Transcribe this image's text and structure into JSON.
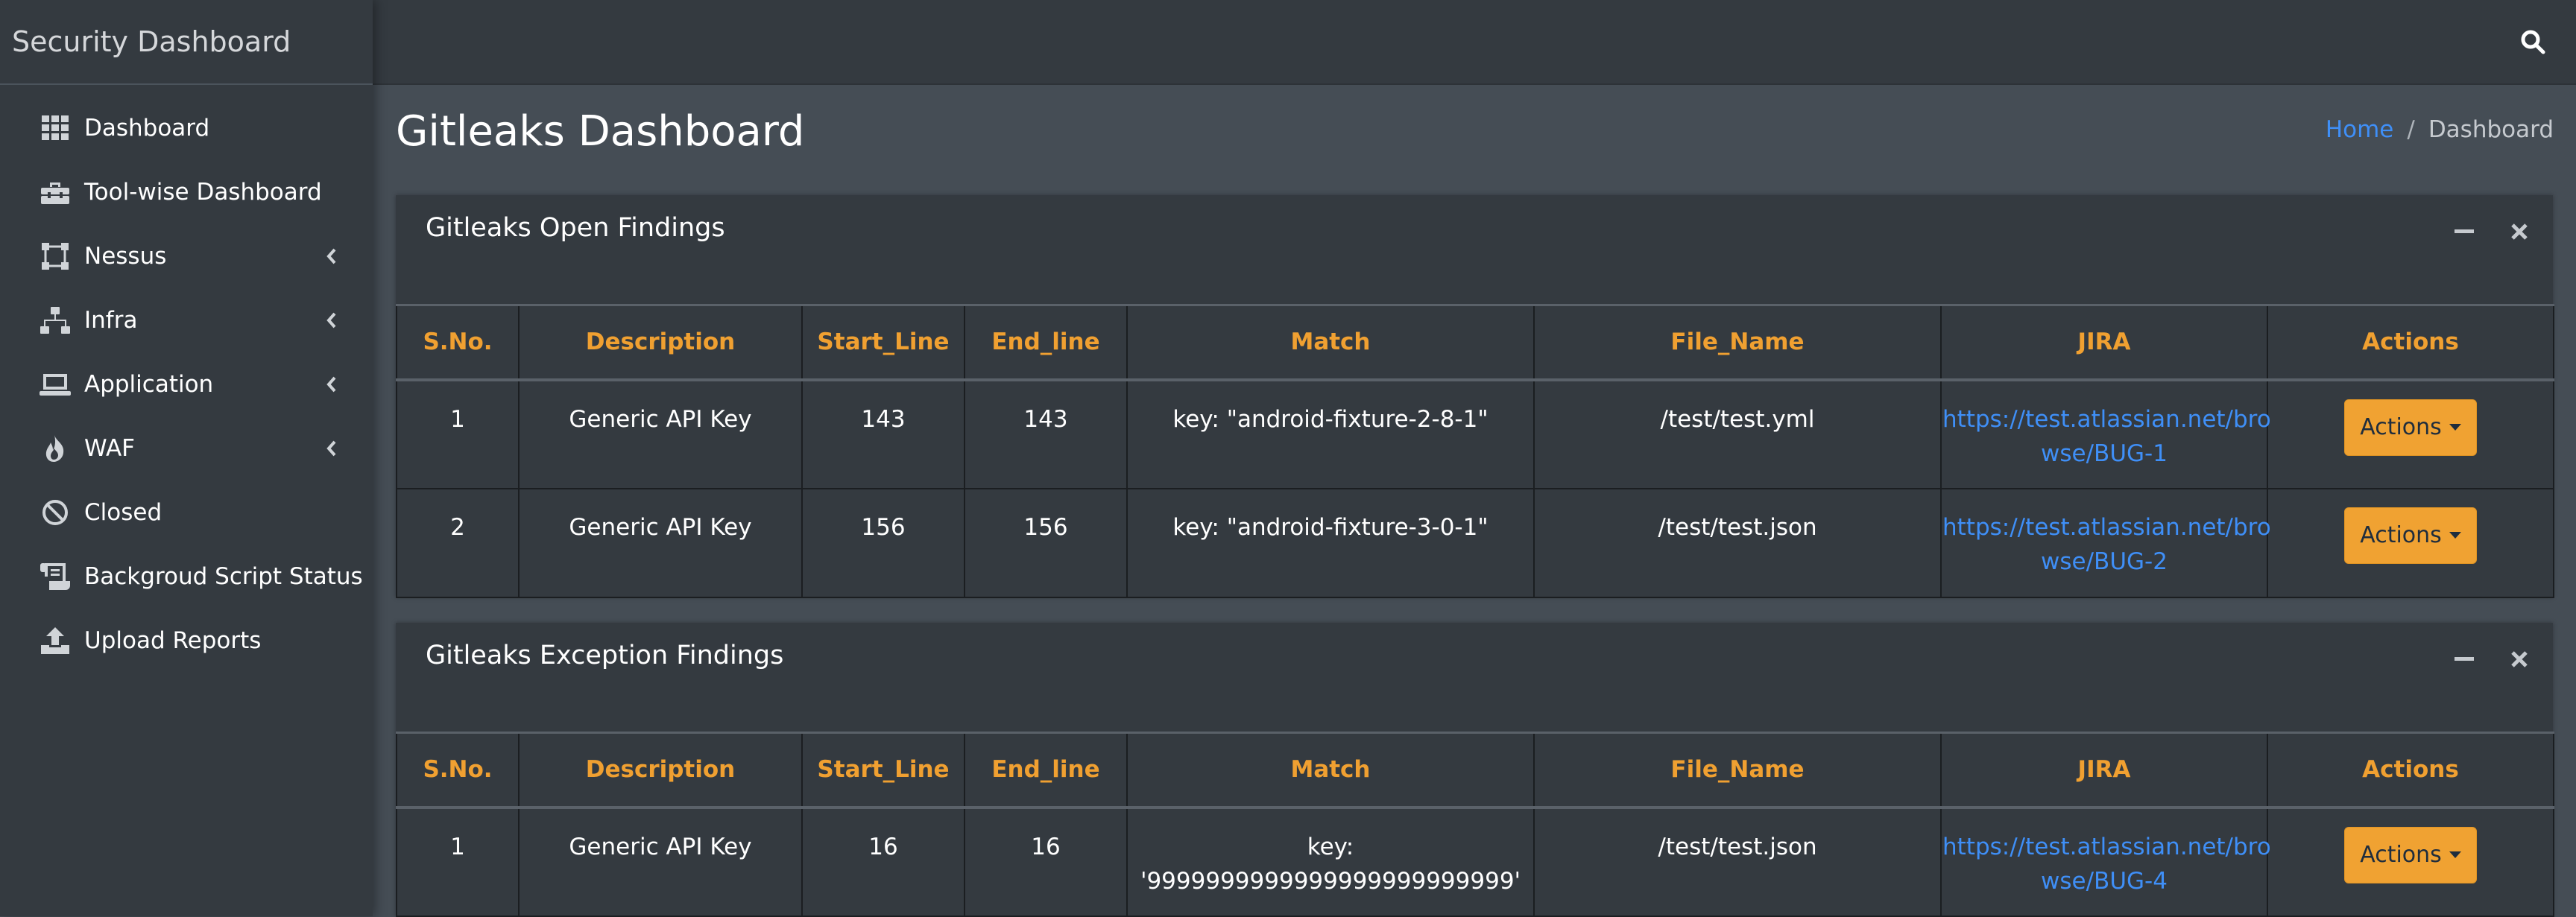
{
  "app": {
    "brand": "Security Dashboard"
  },
  "sidebar": {
    "items": [
      {
        "label": "Dashboard",
        "icon": "grid-icon"
      },
      {
        "label": "Tool-wise Dashboard",
        "icon": "toolbox-icon"
      },
      {
        "label": "Nessus",
        "icon": "vector-square-icon",
        "has_submenu": true
      },
      {
        "label": "Infra",
        "icon": "network-icon",
        "has_submenu": true
      },
      {
        "label": "Application",
        "icon": "laptop-icon",
        "has_submenu": true
      },
      {
        "label": "WAF",
        "icon": "fire-icon",
        "has_submenu": true
      },
      {
        "label": "Closed",
        "icon": "ban-icon"
      },
      {
        "label": "Backgroud Script Status",
        "icon": "scroll-icon"
      },
      {
        "label": "Upload Reports",
        "icon": "upload-icon"
      }
    ]
  },
  "header": {
    "search_icon": "search-icon"
  },
  "page": {
    "title": "Gitleaks Dashboard",
    "breadcrumb": {
      "home": "Home",
      "separator": "/",
      "current": "Dashboard"
    }
  },
  "columns": [
    "S.No.",
    "Description",
    "Start_Line",
    "End_line",
    "Match",
    "File_Name",
    "JIRA",
    "Actions"
  ],
  "open_findings": {
    "title": "Gitleaks Open Findings",
    "rows": [
      {
        "sno": "1",
        "description": "Generic API Key",
        "start_line": "143",
        "end_line": "143",
        "match": "key: \"android-fixture-2-8-1\"",
        "file_name": "/test/test.yml",
        "jira_line1": "https://test.atlassian.net/bro",
        "jira_line2": "wse/BUG-1",
        "action": "Actions"
      },
      {
        "sno": "2",
        "description": "Generic API Key",
        "start_line": "156",
        "end_line": "156",
        "match": "key: \"android-fixture-3-0-1\"",
        "file_name": "/test/test.json",
        "jira_line1": "https://test.atlassian.net/bro",
        "jira_line2": "wse/BUG-2",
        "action": "Actions"
      }
    ]
  },
  "exception_findings": {
    "title": "Gitleaks Exception Findings",
    "rows": [
      {
        "sno": "1",
        "description": "Generic API Key",
        "start_line": "16",
        "end_line": "16",
        "match": "key: '9999999999999999999999999'",
        "file_name": "/test/test.json",
        "jira_line1": "https://test.atlassian.net/bro",
        "jira_line2": "wse/BUG-4",
        "action": "Actions"
      }
    ]
  },
  "colors": {
    "accent": "#f0a232",
    "link": "#3f8ff7",
    "header_text": "#f0a031",
    "sidebar_bg": "#343a40",
    "content_bg": "#454d55"
  }
}
